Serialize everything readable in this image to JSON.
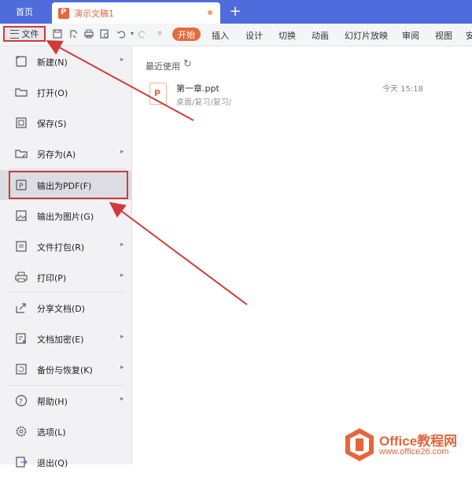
{
  "tabs": {
    "home": "首页",
    "document": "演示文稿1",
    "add": "+"
  },
  "toolbar": {
    "file_label": "文件",
    "start_label": "开始",
    "menu_tabs": [
      "插入",
      "设计",
      "切换",
      "动画",
      "幻灯片放映",
      "审阅",
      "视图",
      "安"
    ]
  },
  "file_menu": {
    "items": [
      {
        "label": "新建(N)",
        "icon": "new-icon",
        "arrow": true
      },
      {
        "label": "打开(O)",
        "icon": "open-icon",
        "arrow": false
      },
      {
        "label": "保存(S)",
        "icon": "save-icon",
        "arrow": false
      },
      {
        "label": "另存为(A)",
        "icon": "save-as-icon",
        "arrow": true
      },
      {
        "label": "输出为PDF(F)",
        "icon": "pdf-icon",
        "arrow": false
      },
      {
        "label": "输出为图片(G)",
        "icon": "image-icon",
        "arrow": false
      },
      {
        "label": "文件打包(R)",
        "icon": "package-icon",
        "arrow": true
      },
      {
        "label": "打印(P)",
        "icon": "print-icon",
        "arrow": true
      },
      {
        "label": "分享文档(D)",
        "icon": "share-icon",
        "arrow": false
      },
      {
        "label": "文档加密(E)",
        "icon": "encrypt-icon",
        "arrow": true
      },
      {
        "label": "备份与恢复(K)",
        "icon": "backup-icon",
        "arrow": true
      },
      {
        "label": "帮助(H)",
        "icon": "help-icon",
        "arrow": true
      },
      {
        "label": "选项(L)",
        "icon": "gear-icon",
        "arrow": false
      },
      {
        "label": "退出(Q)",
        "icon": "exit-icon",
        "arrow": false
      }
    ],
    "selected_index": 4
  },
  "recent": {
    "title": "最近使用",
    "files": [
      {
        "name": "第一章.ppt",
        "path": "桌面/复习/复习/",
        "time": "今天 15:18"
      }
    ]
  },
  "watermark": {
    "title": "Office教程网",
    "url": "www.office26.com"
  },
  "colors": {
    "accent": "#4f6bdc",
    "highlight_red": "#d23a3a",
    "orange": "#e66b3c"
  }
}
